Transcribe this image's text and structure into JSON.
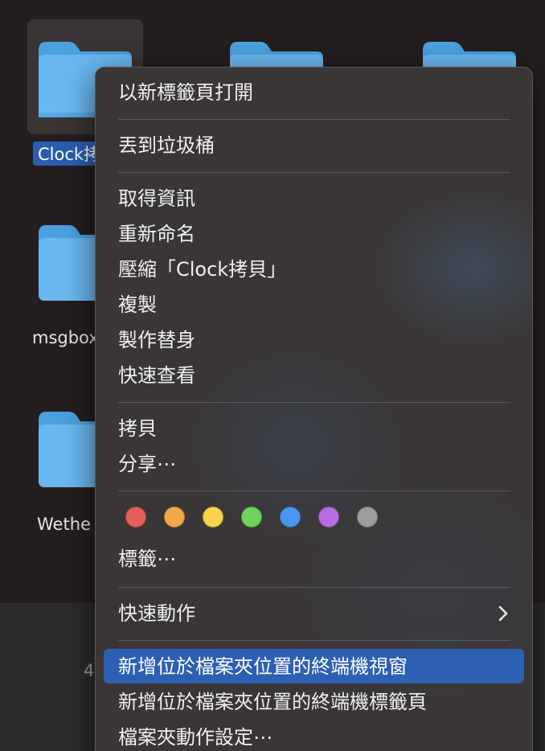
{
  "folders": [
    {
      "label": "Clock拷貝",
      "selected": true
    },
    {
      "label": "",
      "selected": false
    },
    {
      "label": "",
      "selected": false
    },
    {
      "label": "msgbox",
      "selected": false
    },
    {
      "label": "Wethe",
      "selected": false
    }
  ],
  "status_bar": {
    "text": "4"
  },
  "context_menu": {
    "open_in_new_tab": "以新標籤頁打開",
    "move_to_trash": "丟到垃圾桶",
    "get_info": "取得資訊",
    "rename": "重新命名",
    "compress": "壓縮「Clock拷貝」",
    "duplicate": "複製",
    "make_alias": "製作替身",
    "quick_look": "快速查看",
    "copy": "拷貝",
    "share": "分享⋯",
    "tags_label": "標籤⋯",
    "tag_colors": [
      "#e5605d",
      "#f0a94a",
      "#f5d54b",
      "#6fd35f",
      "#4a95f2",
      "#b66de2",
      "#9c9c9f"
    ],
    "tag_names": [
      "red",
      "orange",
      "yellow",
      "green",
      "blue",
      "purple",
      "gray"
    ],
    "quick_actions": "快速動作",
    "new_terminal_window": "新增位於檔案夾位置的終端機視窗",
    "new_terminal_tab": "新增位於檔案夾位置的終端機標籤頁",
    "folder_actions_setup": "檔案夾動作設定⋯"
  },
  "colors": {
    "folder_blue": "#63b5ef",
    "selection_blue": "#2a5db0",
    "menu_highlight": "#2d5fb3"
  }
}
